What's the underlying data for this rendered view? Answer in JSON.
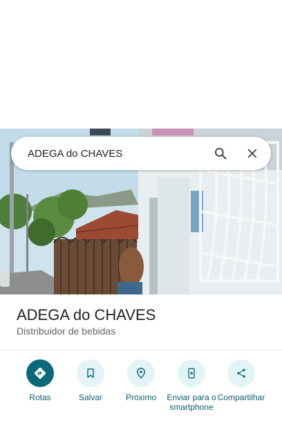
{
  "search": {
    "query": "ADEGA do CHAVES"
  },
  "place": {
    "name": "ADEGA do CHAVES",
    "category": "Distribuidor de bebidas"
  },
  "actions": [
    {
      "label": "Rotas",
      "icon": "directions-icon"
    },
    {
      "label": "Salvar",
      "icon": "bookmark-icon"
    },
    {
      "label": "Próximo",
      "icon": "nearby-icon"
    },
    {
      "label": "Enviar para o smartphone",
      "icon": "send-to-phone-icon"
    },
    {
      "label": "Compartilhar",
      "icon": "share-icon"
    }
  ],
  "colors": {
    "accent": "#0b6a7a",
    "action_bg": "#e3f4f6",
    "label": "#0b5c6b"
  }
}
